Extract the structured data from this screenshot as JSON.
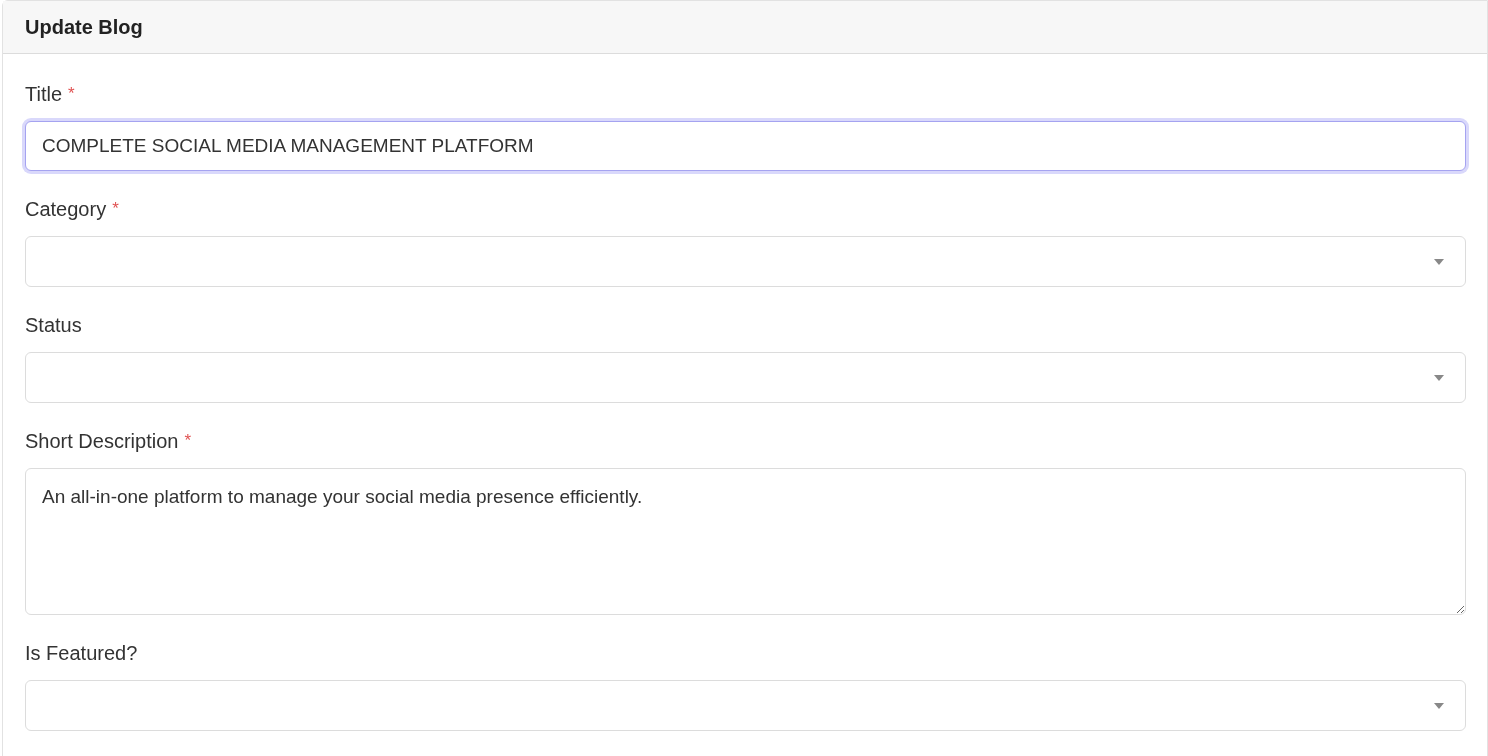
{
  "card": {
    "title": "Update Blog"
  },
  "fields": [
    {
      "kind": "text",
      "label": "Title",
      "required": true,
      "value": "COMPLETE SOCIAL MEDIA MANAGEMENT PLATFORM",
      "focused": true
    },
    {
      "kind": "select",
      "label": "Category",
      "required": true,
      "focused": false
    },
    {
      "kind": "select",
      "label": "Status",
      "required": false,
      "focused": false
    },
    {
      "kind": "textarea",
      "label": "Short Description",
      "required": true,
      "value": "An all-in-one platform to manage your social media presence efficiently.",
      "focused": false
    },
    {
      "kind": "select",
      "label": "Is Featured?",
      "required": false,
      "focused": false
    }
  ],
  "required_mark": "*"
}
